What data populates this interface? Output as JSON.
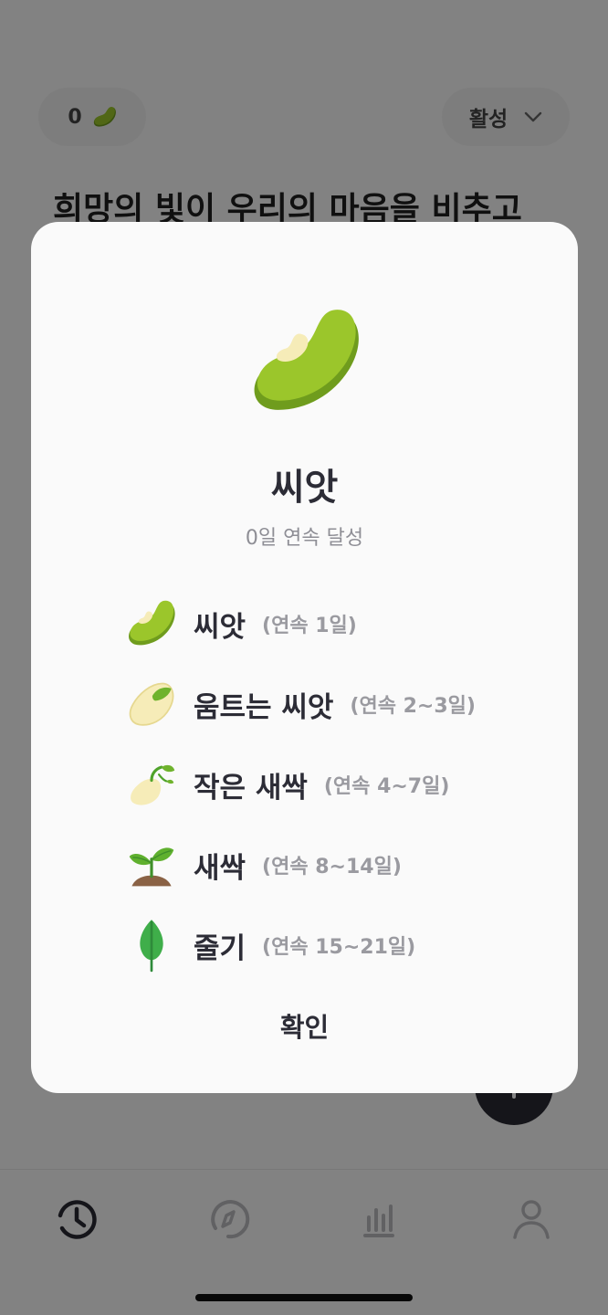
{
  "header": {
    "streak_count": "0",
    "status_label": "활성"
  },
  "main": {
    "headline": "희망의 빛이 우리의 마음을 비추고"
  },
  "tabbar": {
    "tabs": [
      {
        "icon": "clock-icon",
        "active": true
      },
      {
        "icon": "compass-icon",
        "active": false
      },
      {
        "icon": "bar-chart-icon",
        "active": false
      },
      {
        "icon": "profile-icon",
        "active": false
      }
    ]
  },
  "modal": {
    "title": "씨앗",
    "subtitle": "0일 연속 달성",
    "hero_icon": "bean-seed-icon",
    "stages": [
      {
        "name": "씨앗",
        "range": "(연속 1일)",
        "icon": "bean-seed-icon"
      },
      {
        "name": "움트는 씨앗",
        "range": "(연속 2~3일)",
        "icon": "sprouting-seed-icon"
      },
      {
        "name": "작은 새싹",
        "range": "(연속 4~7일)",
        "icon": "small-sprout-icon"
      },
      {
        "name": "새싹",
        "range": "(연속 8~14일)",
        "icon": "seedling-icon"
      },
      {
        "name": "줄기",
        "range": "(연속 15~21일)",
        "icon": "leaf-stem-icon"
      }
    ],
    "confirm_label": "확인"
  },
  "colors": {
    "bean_green": "#9bc62b",
    "bean_dark": "#6f9c1d",
    "text_dark": "#2c2c36",
    "text_muted": "#9a9aa0",
    "scrim": "rgba(0,0,0,0.48)"
  }
}
